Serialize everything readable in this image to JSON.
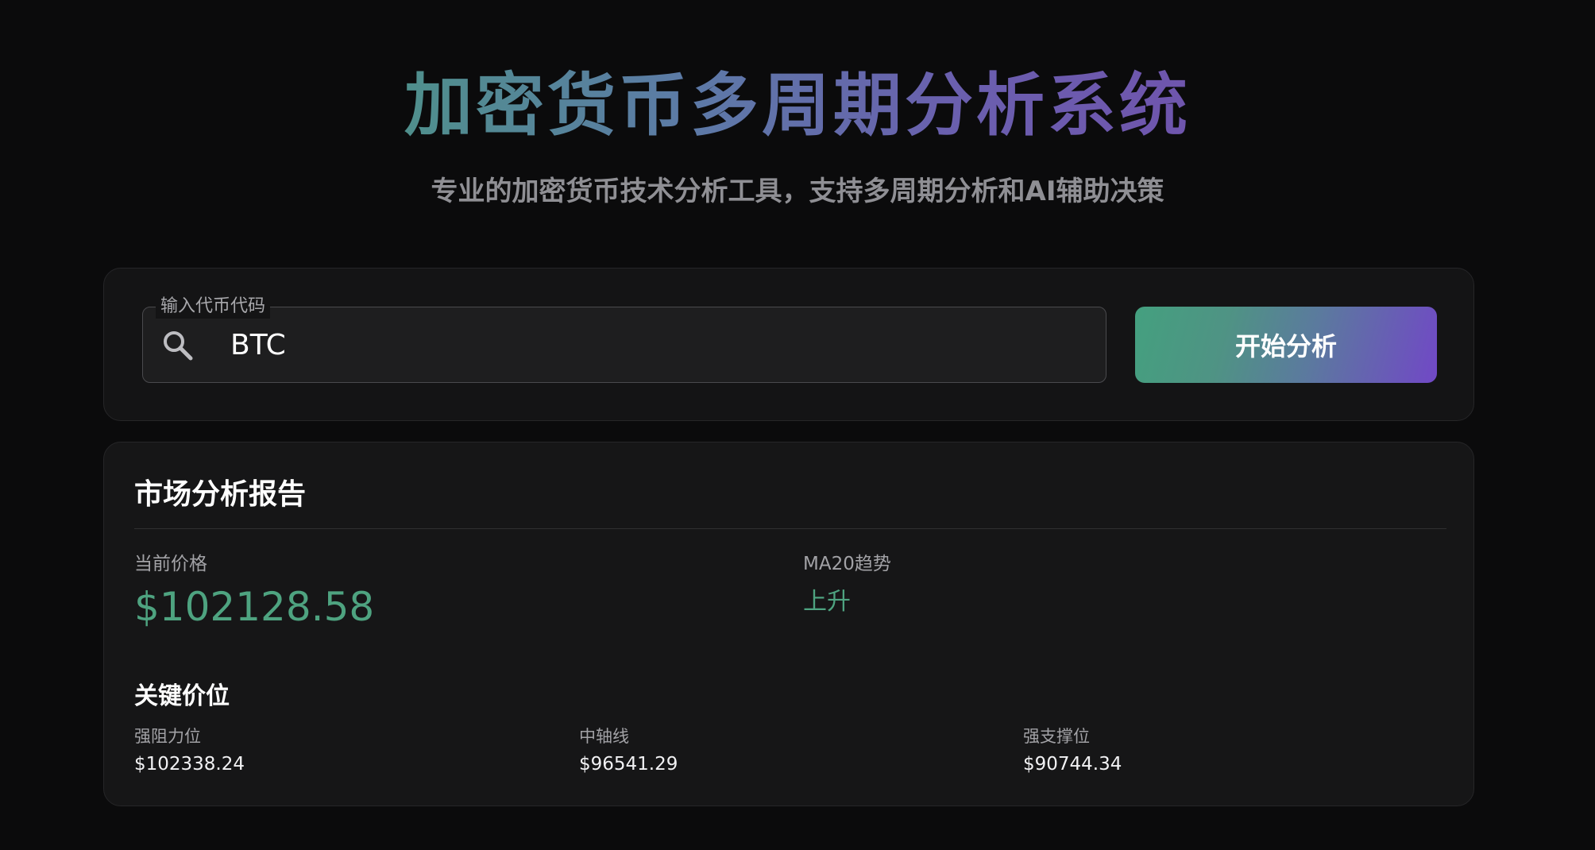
{
  "header": {
    "title": "加密货币多周期分析系统",
    "subtitle": "专业的加密货币技术分析工具，支持多周期分析和AI辅助决策"
  },
  "search": {
    "label": "输入代币代码",
    "value": "BTC",
    "icon": "search-icon",
    "button_label": "开始分析"
  },
  "report": {
    "title": "市场分析报告",
    "current_price_label": "当前价格",
    "current_price": "$102128.58",
    "ma20_label": "MA20趋势",
    "ma20_value": "上升",
    "key_levels_title": "关键价位",
    "levels": [
      {
        "label": "强阻力位",
        "value": "$102338.24"
      },
      {
        "label": "中轴线",
        "value": "$96541.29"
      },
      {
        "label": "强支撑位",
        "value": "$90744.34"
      }
    ]
  },
  "colors": {
    "background": "#0b0b0c",
    "accent_green": "#4ea380",
    "accent_purple": "#7148c6"
  }
}
